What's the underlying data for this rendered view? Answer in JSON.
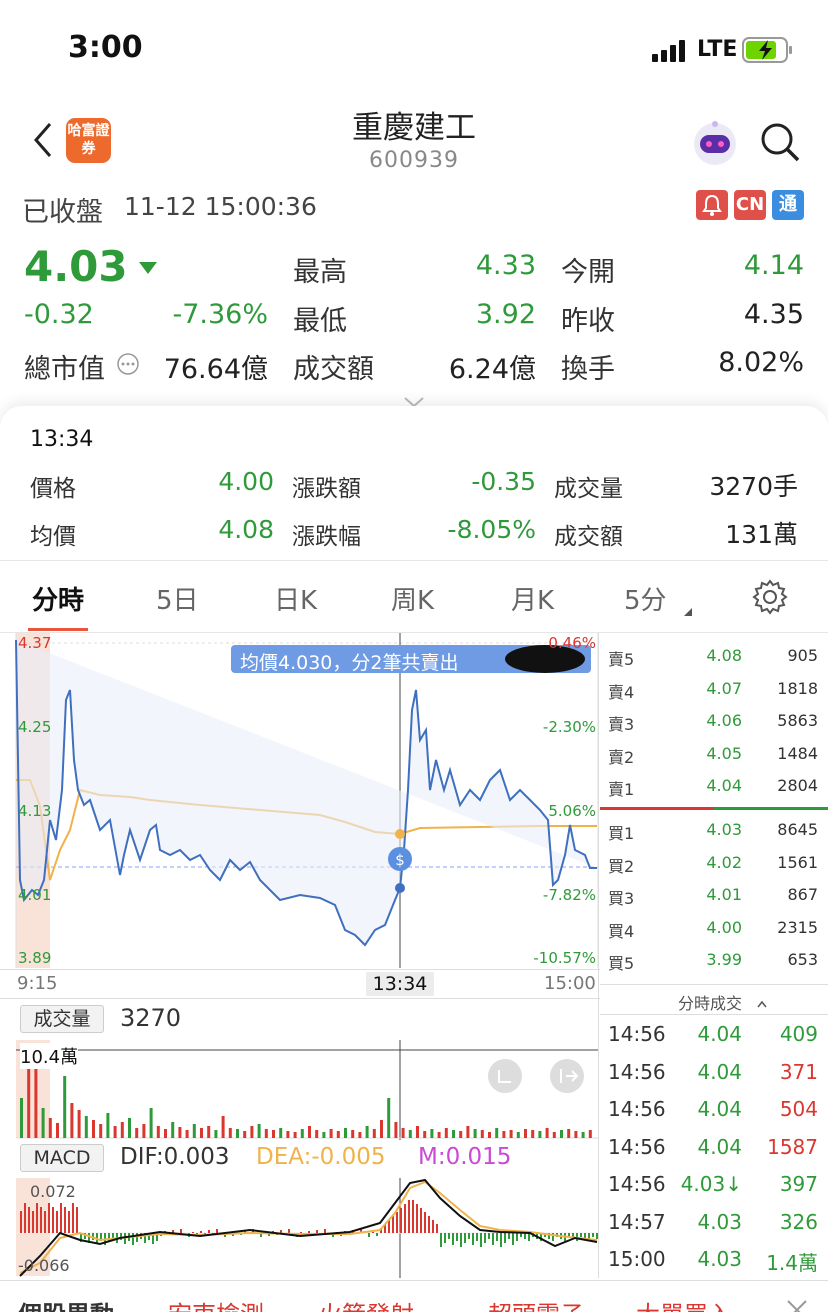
{
  "status_bar": {
    "time": "3:00",
    "network": "LTE"
  },
  "header": {
    "title": "重慶建工",
    "code": "600939",
    "broker_logo": "哈富證券"
  },
  "market_status": {
    "label": "已收盤",
    "datetime": "11-12 15:00:36"
  },
  "badges": {
    "alert": "bell-icon",
    "cn": "CN",
    "tong": "通"
  },
  "quote": {
    "price": "4.03",
    "change": "-0.32",
    "change_pct": "-7.36%",
    "market_cap_label": "總市值",
    "market_cap": "76.64億",
    "high_label": "最高",
    "high": "4.33",
    "low_label": "最低",
    "low": "3.92",
    "turnover_label": "成交額",
    "turnover": "6.24億",
    "open_label": "今開",
    "open": "4.14",
    "prev_close_label": "昨收",
    "prev_close": "4.35",
    "turnover_rate_label": "換手",
    "turnover_rate": "8.02%"
  },
  "detail": {
    "time": "13:34",
    "price_label": "價格",
    "price": "4.00",
    "avg_label": "均價",
    "avg": "4.08",
    "chg_amt_label": "漲跌額",
    "chg_amt": "-0.35",
    "chg_pct_label": "漲跌幅",
    "chg_pct": "-8.05%",
    "vol_label": "成交量",
    "vol": "3270手",
    "amt_label": "成交額",
    "amt": "131萬"
  },
  "tabs": [
    "分時",
    "5日",
    "日K",
    "周K",
    "月K",
    "5分"
  ],
  "chart": {
    "y_left": [
      "4.37",
      "4.25",
      "4.13",
      "4.01",
      "3.89"
    ],
    "y_right": [
      "0.46%",
      "-2.30%",
      "5.06%",
      "-7.82%",
      "-10.57%"
    ],
    "x_labels": [
      "9:15",
      "13:34",
      "15:00"
    ],
    "tooltip": "均價4.030，分2筆共賣出",
    "volume_label": "成交量",
    "volume_value": "3270",
    "volume_max": "10.4萬",
    "macd_label": "MACD",
    "dif": "DIF:0.003",
    "dea": "DEA:-0.005",
    "m": "M:0.015",
    "macd_top": "0.072",
    "macd_bottom": "-0.066"
  },
  "chart_data": {
    "type": "line",
    "x": [
      "9:15",
      "13:34",
      "15:00"
    ],
    "series": [
      {
        "name": "price",
        "values": [
          4.07,
          4.0,
          4.03
        ]
      },
      {
        "name": "均價",
        "values": [
          4.13,
          4.03,
          4.08
        ]
      }
    ],
    "ylim": [
      3.89,
      4.37
    ]
  },
  "order_book": {
    "asks": [
      {
        "label": "賣5",
        "price": "4.08",
        "vol": "905"
      },
      {
        "label": "賣4",
        "price": "4.07",
        "vol": "1818"
      },
      {
        "label": "賣3",
        "price": "4.06",
        "vol": "5863"
      },
      {
        "label": "賣2",
        "price": "4.05",
        "vol": "1484"
      },
      {
        "label": "賣1",
        "price": "4.04",
        "vol": "2804"
      }
    ],
    "bids": [
      {
        "label": "買1",
        "price": "4.03",
        "vol": "8645"
      },
      {
        "label": "買2",
        "price": "4.02",
        "vol": "1561"
      },
      {
        "label": "買3",
        "price": "4.01",
        "vol": "867"
      },
      {
        "label": "買4",
        "price": "4.00",
        "vol": "2315"
      },
      {
        "label": "買5",
        "price": "3.99",
        "vol": "653"
      }
    ]
  },
  "trades_header": "分時成交",
  "trades": [
    {
      "time": "14:56",
      "price": "4.04",
      "vol": "409",
      "color": "green"
    },
    {
      "time": "14:56",
      "price": "4.04",
      "vol": "371",
      "color": "red"
    },
    {
      "time": "14:56",
      "price": "4.04",
      "vol": "504",
      "color": "red"
    },
    {
      "time": "14:56",
      "price": "4.04",
      "vol": "1587",
      "color": "red"
    },
    {
      "time": "14:56",
      "price": "4.03↓",
      "vol": "397",
      "color": "green"
    },
    {
      "time": "14:57",
      "price": "4.03",
      "vol": "326",
      "color": "green"
    },
    {
      "time": "15:00",
      "price": "4.03",
      "vol": "1.4萬",
      "color": "green"
    }
  ],
  "bottom_tabs": [
    "個股異動",
    "宏東檢測",
    "火箭發射",
    "超頭電子",
    "大單買入"
  ]
}
